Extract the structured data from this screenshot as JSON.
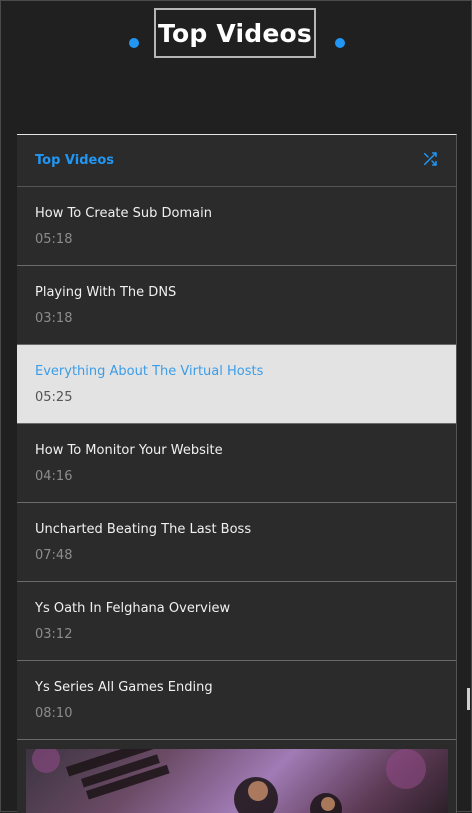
{
  "header": {
    "title": "Top Videos"
  },
  "panel": {
    "label": "Top Videos",
    "shuffle_icon": "shuffle-icon",
    "items": [
      {
        "title": "How To Create Sub Domain",
        "duration": "05:18",
        "active": false
      },
      {
        "title": "Playing With The DNS",
        "duration": "03:18",
        "active": false
      },
      {
        "title": "Everything About The Virtual Hosts",
        "duration": "05:25",
        "active": true
      },
      {
        "title": "How To Monitor Your Website",
        "duration": "04:16",
        "active": false
      },
      {
        "title": "Uncharted Beating The Last Boss",
        "duration": "07:48",
        "active": false
      },
      {
        "title": "Ys Oath In Felghana Overview",
        "duration": "03:12",
        "active": false
      },
      {
        "title": "Ys Series All Games Ending",
        "duration": "08:10",
        "active": false
      }
    ]
  },
  "colors": {
    "accent": "#2196f3",
    "background": "#202020",
    "panel": "#2b2b2b",
    "active_row": "#e3e3e3"
  }
}
